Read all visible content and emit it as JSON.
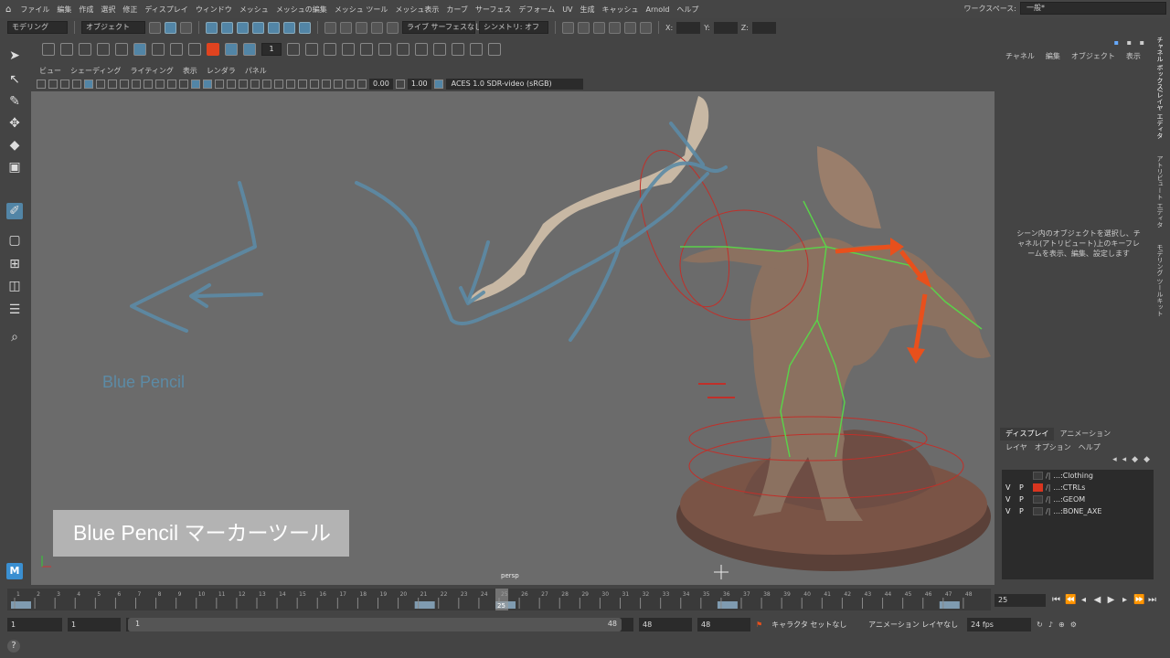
{
  "menubar": {
    "items": [
      "ファイル",
      "編集",
      "作成",
      "選択",
      "修正",
      "ディスプレイ",
      "ウィンドウ",
      "メッシュ",
      "メッシュの編集",
      "メッシュ ツール",
      "メッシュ表示",
      "カーブ",
      "サーフェス",
      "デフォーム",
      "UV",
      "生成",
      "キャッシュ",
      "Arnold",
      "ヘルプ"
    ],
    "workspace_label": "ワークスペース:",
    "workspace_value": "一般*"
  },
  "statusline": {
    "mode": "モデリング",
    "object_mode": "オブジェクト",
    "live_surface": "ライブ サーフェスなし",
    "symmetry": "シンメトリ: オフ",
    "x_label": "X:",
    "y_label": "Y:",
    "z_label": "Z:"
  },
  "shelf": {
    "number_field": "1"
  },
  "viewport": {
    "menu": [
      "ビュー",
      "シェーディング",
      "ライティング",
      "表示",
      "レンダラ",
      "パネル"
    ],
    "field_a": "0.00",
    "field_b": "1.00",
    "color_space": "ACES 1.0 SDR-video (sRGB)",
    "sketch_text": "Blue Pencil",
    "caption": "Blue Pencil マーカーツール",
    "camera": "persp",
    "colors": {
      "pencil": "#5c8ba6",
      "ctrl_arrow": "#e8501c",
      "rig_red": "#c0302a",
      "rig_green": "#5bd14a"
    }
  },
  "right_panel": {
    "tabs": [
      "チャネル",
      "編集",
      "オブジェクト",
      "表示"
    ],
    "message": "シーン内のオブジェクトを選択し、チャネル(アトリビュート)上のキーフレームを表示、編集、設定します",
    "vertical_tabs": [
      "チャネル ボックス/レイヤ エディタ",
      "アトリビュート エディタ",
      "モデリング ツールキット"
    ],
    "layer_tabs": [
      "ディスプレイ",
      "アニメーション"
    ],
    "layer_menu": [
      "レイヤ",
      "オプション",
      "ヘルプ"
    ],
    "layers": [
      {
        "v": "",
        "p": "",
        "name": "...:Clothing",
        "color": "none"
      },
      {
        "v": "V",
        "p": "P",
        "name": "...:CTRLs",
        "color": "red"
      },
      {
        "v": "V",
        "p": "P",
        "name": "...:GEOM",
        "color": "none"
      },
      {
        "v": "V",
        "p": "P",
        "name": "...:BONE_AXE",
        "color": "none"
      }
    ]
  },
  "timeline": {
    "ticks": [
      "1",
      "2",
      "3",
      "4",
      "5",
      "6",
      "7",
      "8",
      "9",
      "10",
      "11",
      "12",
      "13",
      "14",
      "15",
      "16",
      "17",
      "18",
      "19",
      "20",
      "21",
      "22",
      "23",
      "24",
      "25",
      "26",
      "27",
      "28",
      "29",
      "30",
      "31",
      "32",
      "33",
      "34",
      "35",
      "36",
      "37",
      "38",
      "39",
      "40",
      "41",
      "42",
      "43",
      "44",
      "45",
      "46",
      "47",
      "48"
    ],
    "keyframes": [
      1,
      21,
      25,
      36,
      47
    ],
    "current": "25",
    "current_field": "25"
  },
  "range": {
    "start": "1",
    "playback_start": "1",
    "slider_start": "1",
    "slider_end": "48",
    "playback_end": "48",
    "end": "48",
    "character_set": "キャラクタ セットなし",
    "anim_layer": "アニメーション レイヤなし",
    "fps": "24 fps"
  }
}
